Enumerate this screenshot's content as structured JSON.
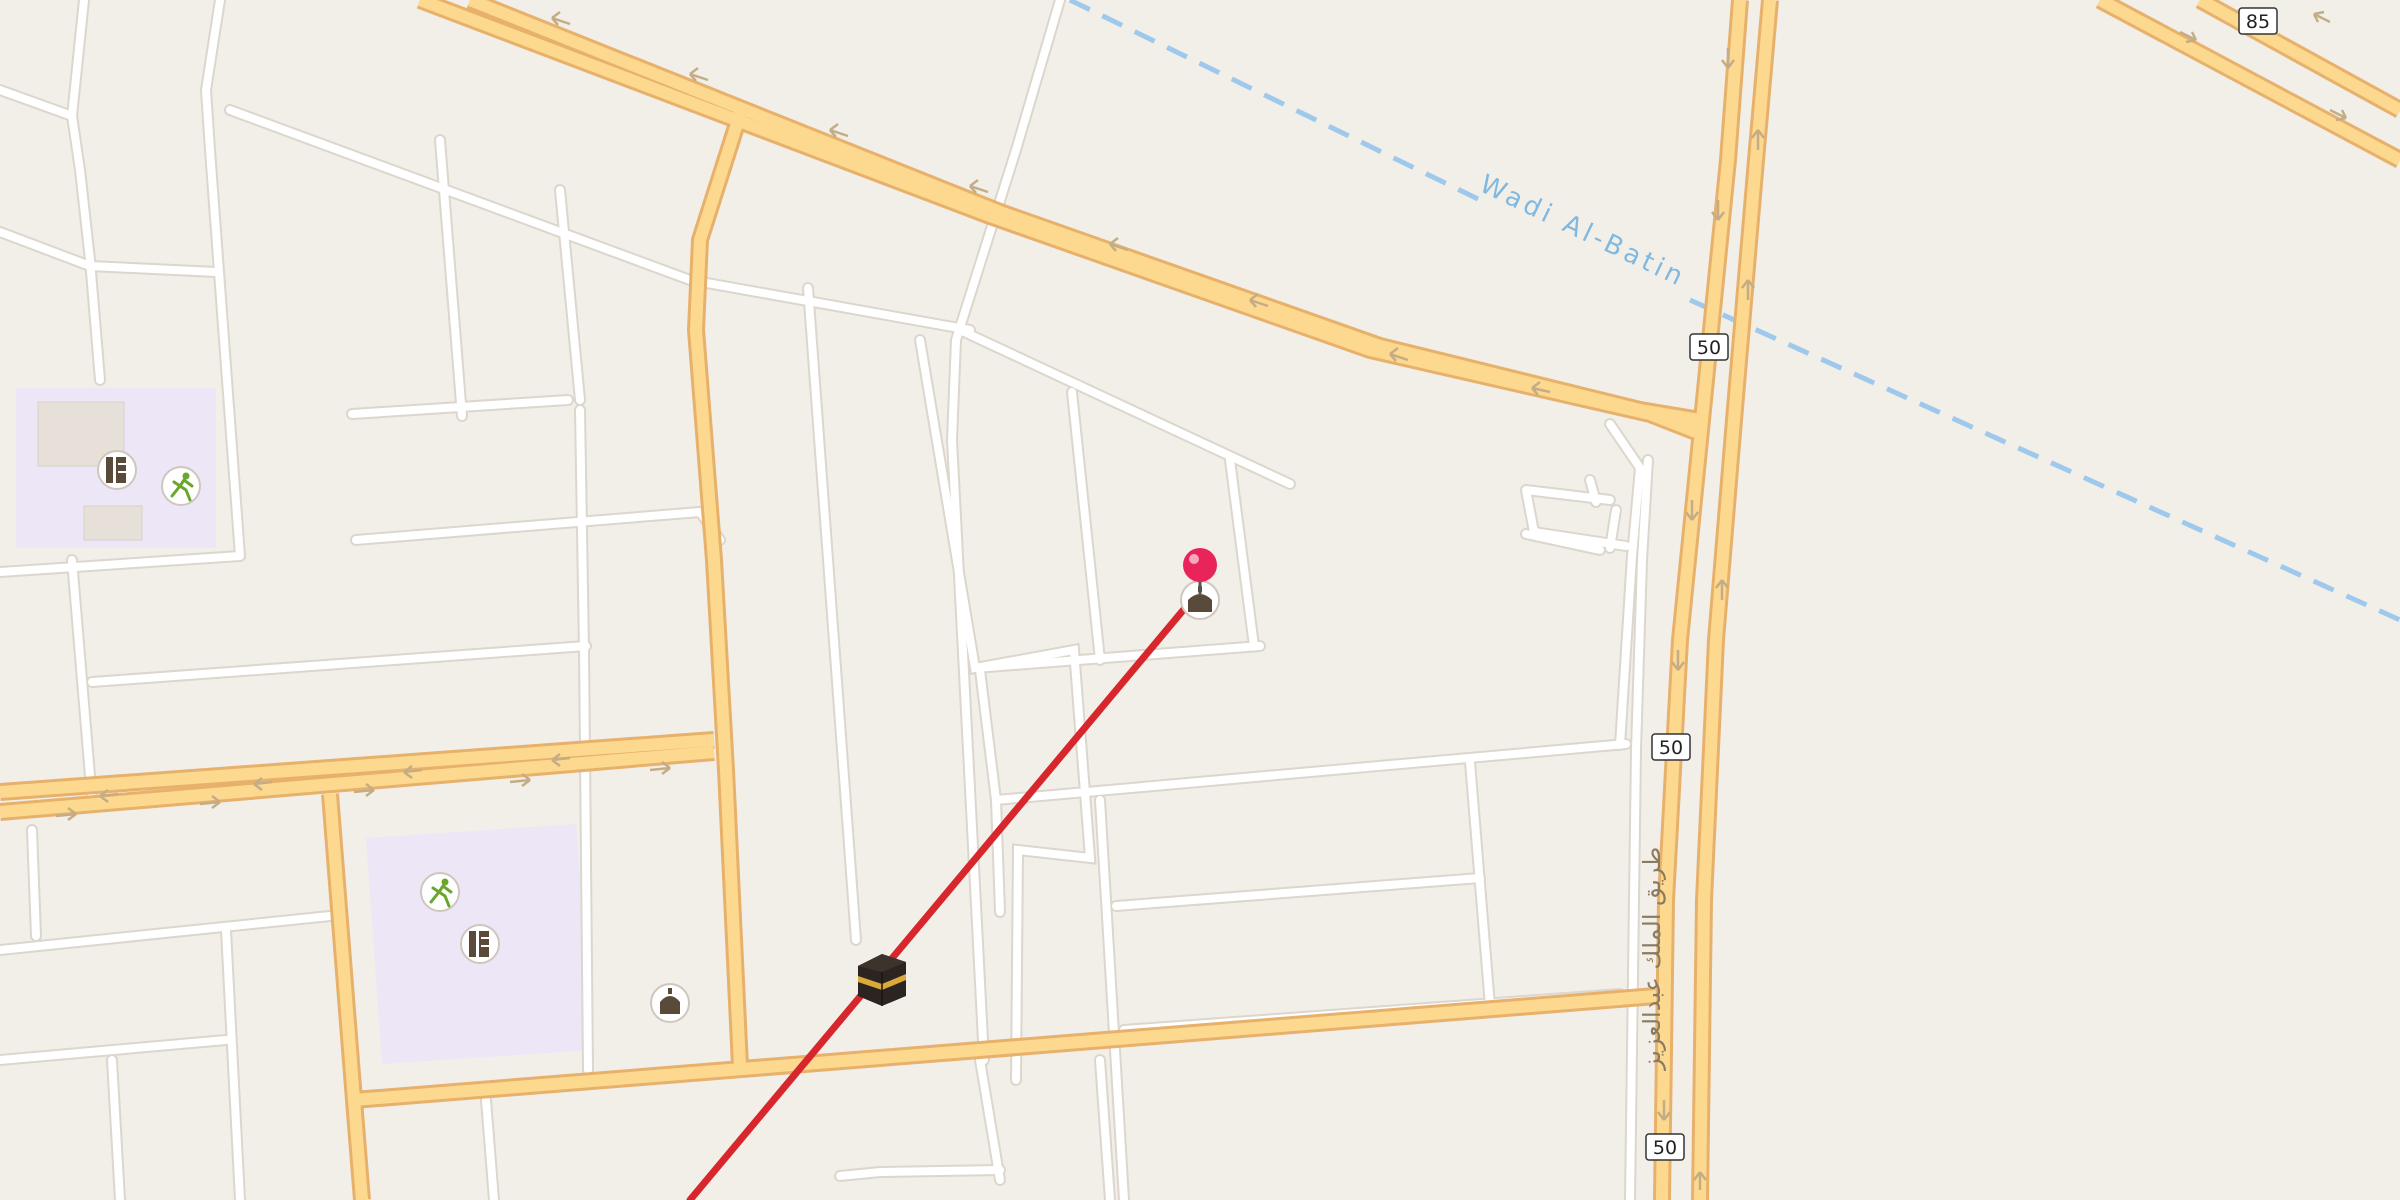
{
  "map": {
    "waterway_label": "Wadi Al-Batin",
    "road_label_arabic": "طريق الملك عبدالعزيز",
    "route_shields": [
      {
        "id": "shield-50-a",
        "text": "50"
      },
      {
        "id": "shield-50-b",
        "text": "50"
      },
      {
        "id": "shield-50-c",
        "text": "50"
      },
      {
        "id": "shield-85",
        "text": "85"
      }
    ],
    "poi_icons": [
      {
        "name": "school-icon",
        "label": "school"
      },
      {
        "name": "sports-icon",
        "label": "sports"
      },
      {
        "name": "school-icon",
        "label": "school"
      },
      {
        "name": "sports-icon",
        "label": "sports"
      },
      {
        "name": "mosque-icon",
        "label": "mosque"
      },
      {
        "name": "mosque-icon",
        "label": "mosque"
      },
      {
        "name": "kaaba-icon",
        "label": "qibla direction"
      },
      {
        "name": "location-pin-icon",
        "label": "selected location"
      }
    ],
    "colors": {
      "background": "#f2efe9",
      "minor_road": "#ffffff",
      "major_road_fill": "#fcd98e",
      "major_road_casing": "#e7b16b",
      "school_area": "#ece6f7",
      "water_dashed": "#9ec9ec",
      "qibla_line": "#d7262c",
      "pin": "#e8245a"
    }
  }
}
